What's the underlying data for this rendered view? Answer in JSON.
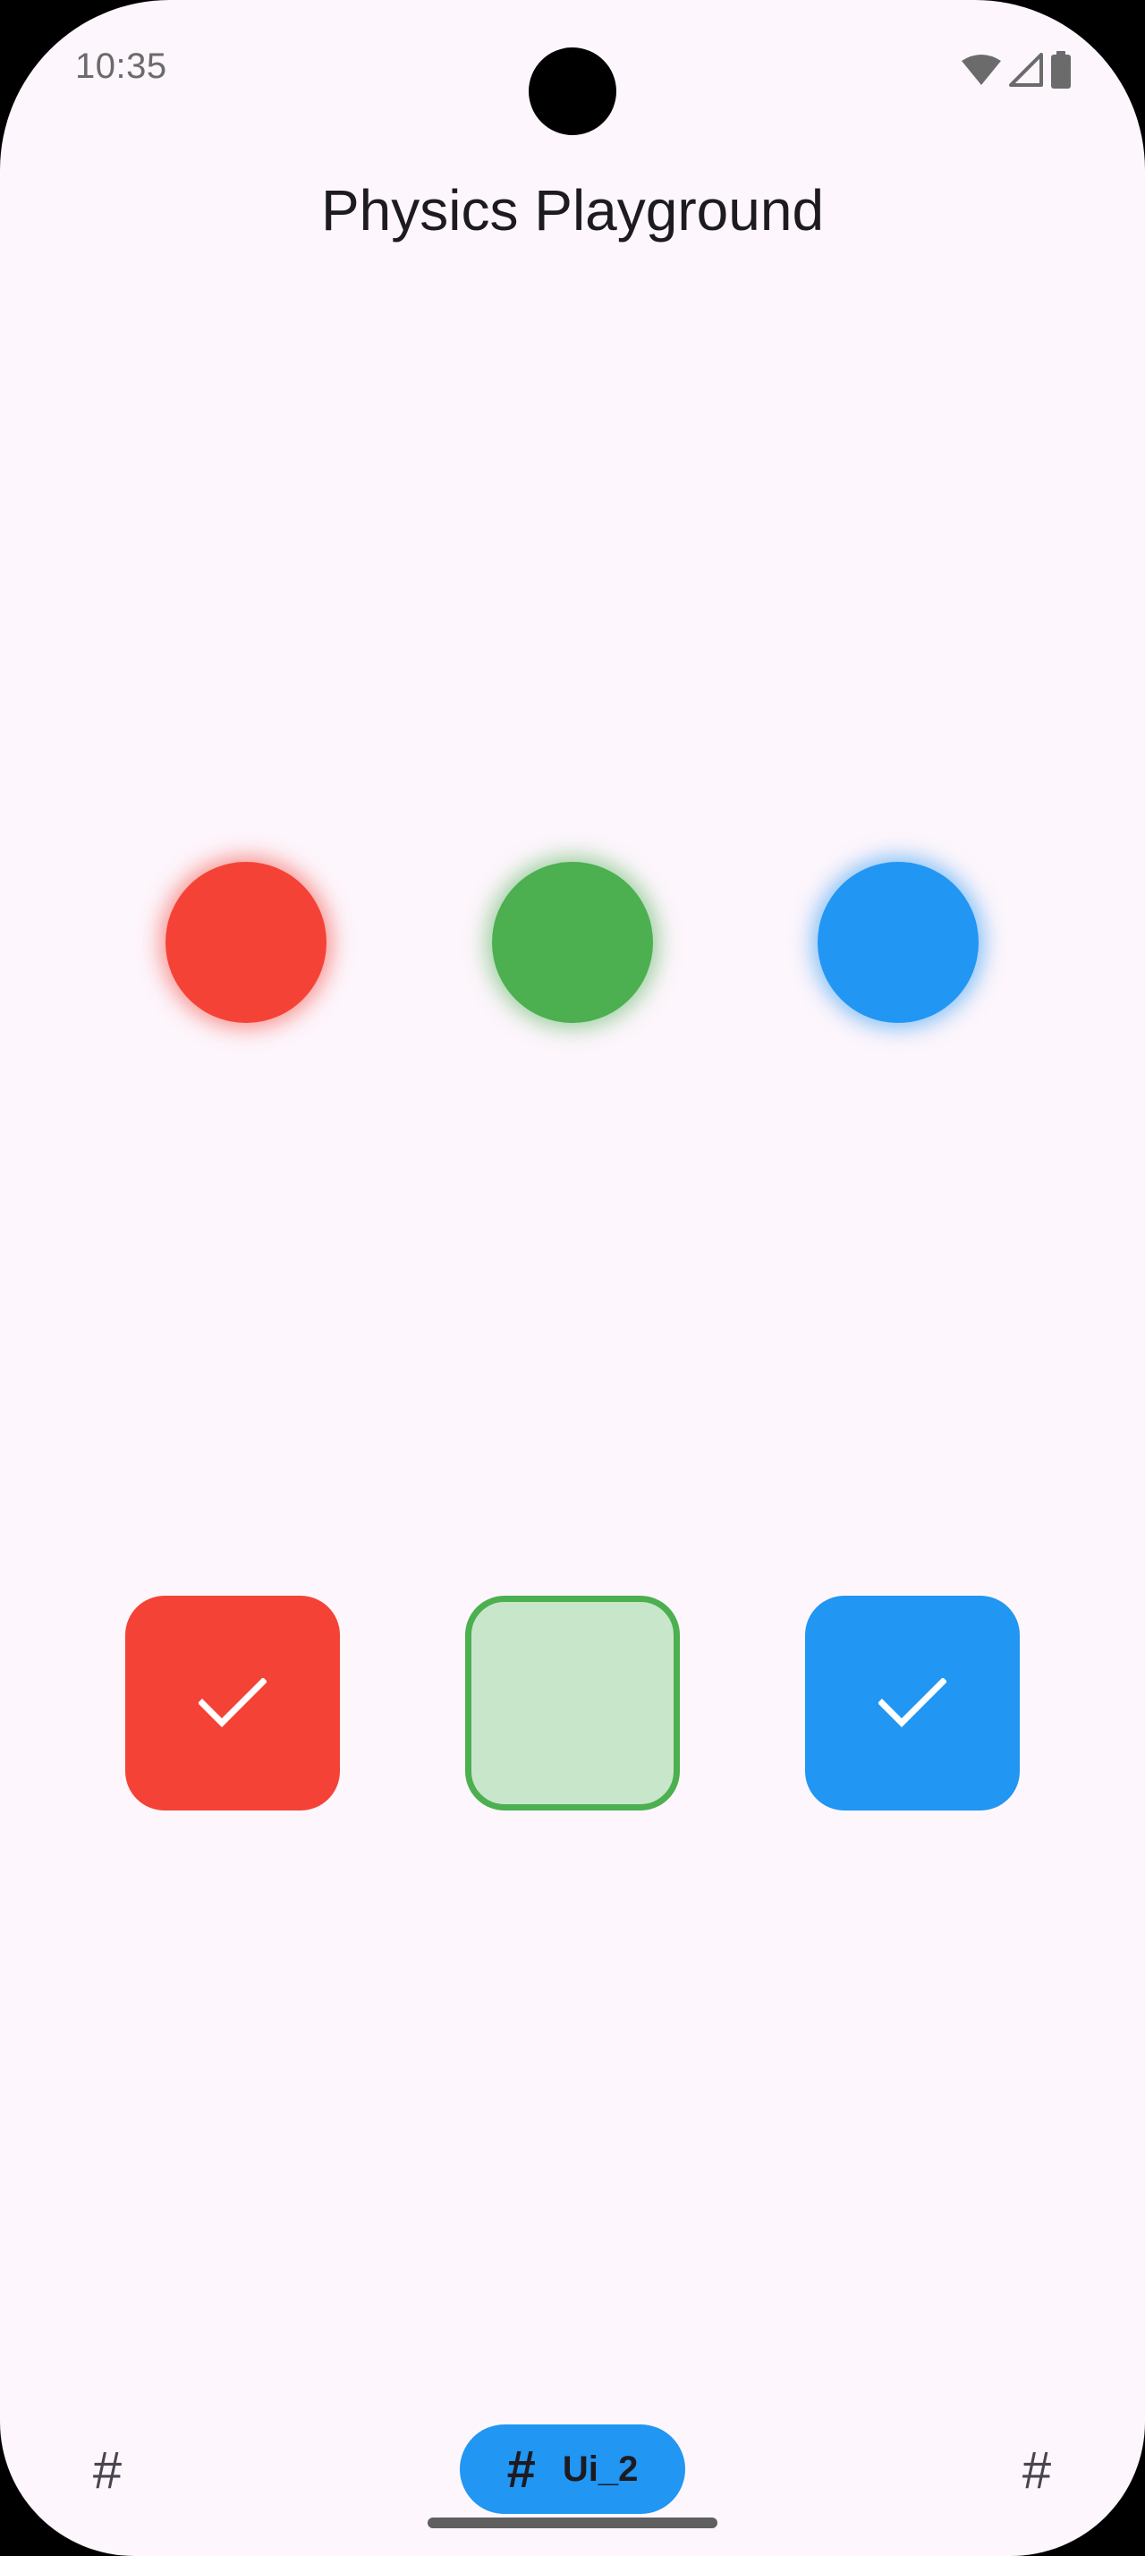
{
  "status_bar": {
    "time": "10:35",
    "icons": [
      "wifi-icon",
      "cellular-signal-icon",
      "battery-icon"
    ]
  },
  "app": {
    "title": "Physics Playground"
  },
  "balls": [
    {
      "name": "red",
      "color": "#F44336"
    },
    {
      "name": "green",
      "color": "#4CAF50"
    },
    {
      "name": "blue",
      "color": "#2196F3"
    }
  ],
  "boxes": [
    {
      "name": "red",
      "color": "#F44336",
      "checked": true
    },
    {
      "name": "green",
      "color": "#4CAF50",
      "checked": false
    },
    {
      "name": "blue",
      "color": "#2196F3",
      "checked": true
    }
  ],
  "bottom_nav": {
    "left_icon": "#",
    "active": {
      "icon": "#",
      "label": "Ui_2"
    },
    "right_icon": "#"
  },
  "colors": {
    "background": "#FDF6FC",
    "accent": "#2196F3"
  }
}
